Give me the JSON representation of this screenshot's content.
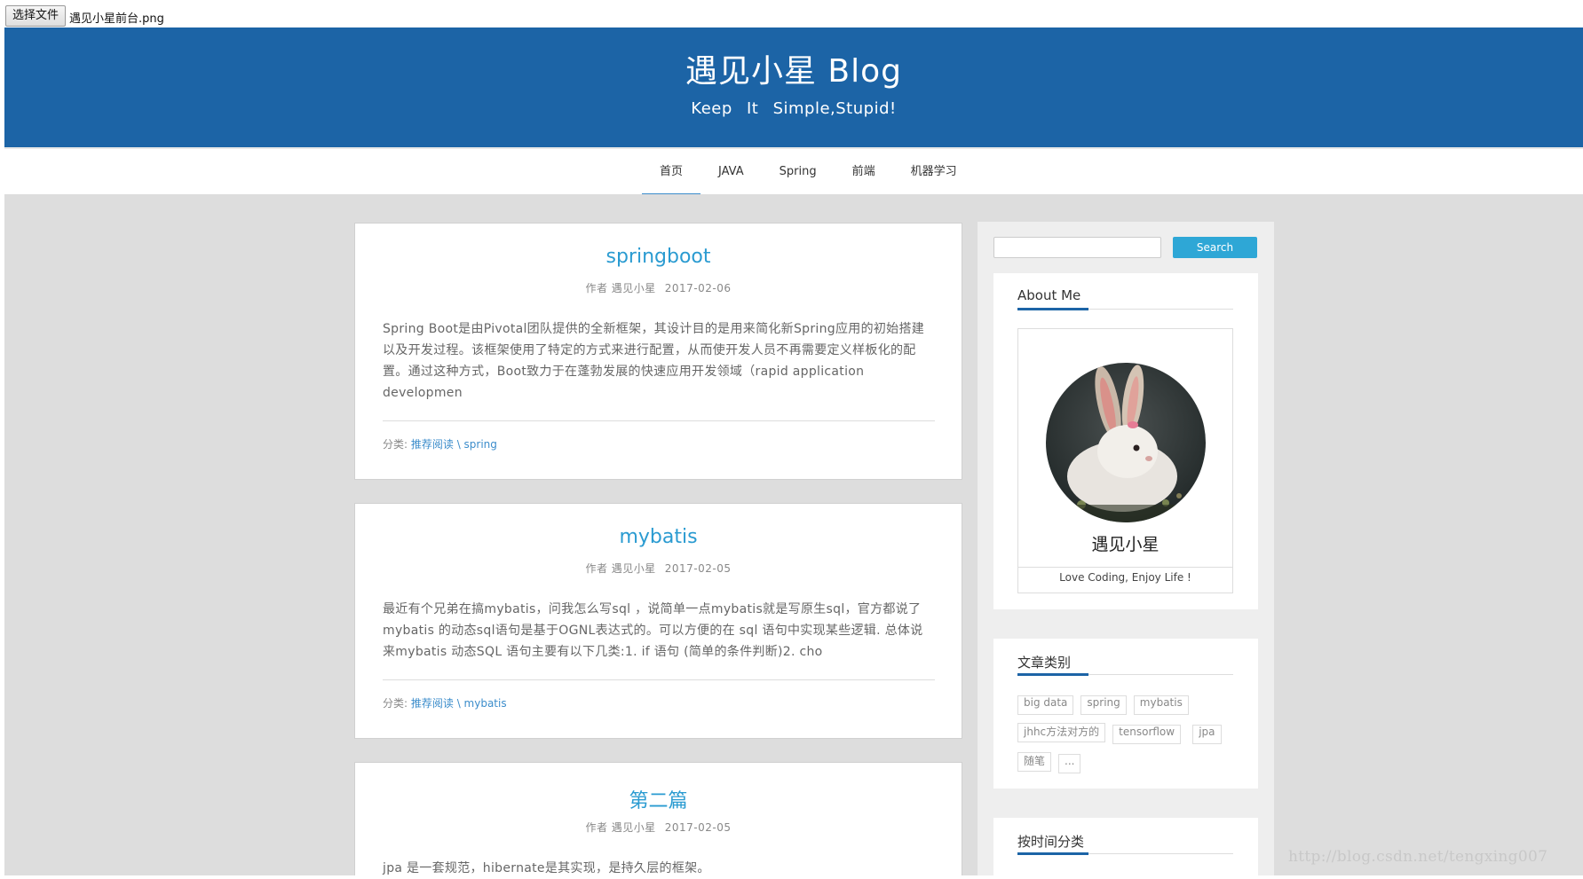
{
  "file_input": {
    "button_label": "选择文件",
    "file_name": "遇见小星前台.png"
  },
  "header": {
    "title": "遇见小星 Blog",
    "subtitle": "Keep It Simple,Stupid!"
  },
  "nav": {
    "items": [
      "首页",
      "JAVA",
      "Spring",
      "前端",
      "机器学习"
    ],
    "active_index": 0
  },
  "posts": [
    {
      "title": "springboot",
      "author_label": "作者 遇见小星",
      "date": "2017-02-06",
      "excerpt": "Spring Boot是由Pivotal团队提供的全新框架，其设计目的是用来简化新Spring应用的初始搭建以及开发过程。该框架使用了特定的方式来进行配置，从而使开发人员不再需要定义样板化的配置。通过这种方式，Boot致力于在蓬勃发展的快速应用开发领域（rapid application developmen",
      "category_label": "分类:",
      "category_path": "推荐阅读 \\ spring"
    },
    {
      "title": "mybatis",
      "author_label": "作者 遇见小星",
      "date": "2017-02-05",
      "excerpt": "最近有个兄弟在搞mybatis，问我怎么写sql ，说简单一点mybatis就是写原生sql，官方都说了 mybatis 的动态sql语句是基于OGNL表达式的。可以方便的在 sql 语句中实现某些逻辑. 总体说来mybatis 动态SQL 语句主要有以下几类:1. if 语句 (简单的条件判断)2. cho",
      "category_label": "分类:",
      "category_path": "推荐阅读 \\ mybatis"
    },
    {
      "title": "第二篇",
      "author_label": "作者 遇见小星",
      "date": "2017-02-05",
      "excerpt": "jpa 是一套规范，hibernate是其实现，是持久层的框架。"
    }
  ],
  "sidebar": {
    "search_button": "Search",
    "about": {
      "title": "About Me",
      "name": "遇见小星",
      "motto": "Love Coding, Enjoy Life !"
    },
    "categories": {
      "title": "文章类别",
      "tags": [
        "big data",
        "spring",
        "mybatis",
        "jhhc方法对方的",
        "tensorflow",
        "jpa",
        "随笔",
        "..."
      ]
    },
    "archive": {
      "title": "按时间分类"
    }
  },
  "watermark": "http://blog.csdn.net/tengxing007",
  "colors": {
    "header_bg": "#1c64a6",
    "link": "#2a9bd1",
    "button": "#2ea7d6",
    "page_bg": "#dddddd"
  }
}
